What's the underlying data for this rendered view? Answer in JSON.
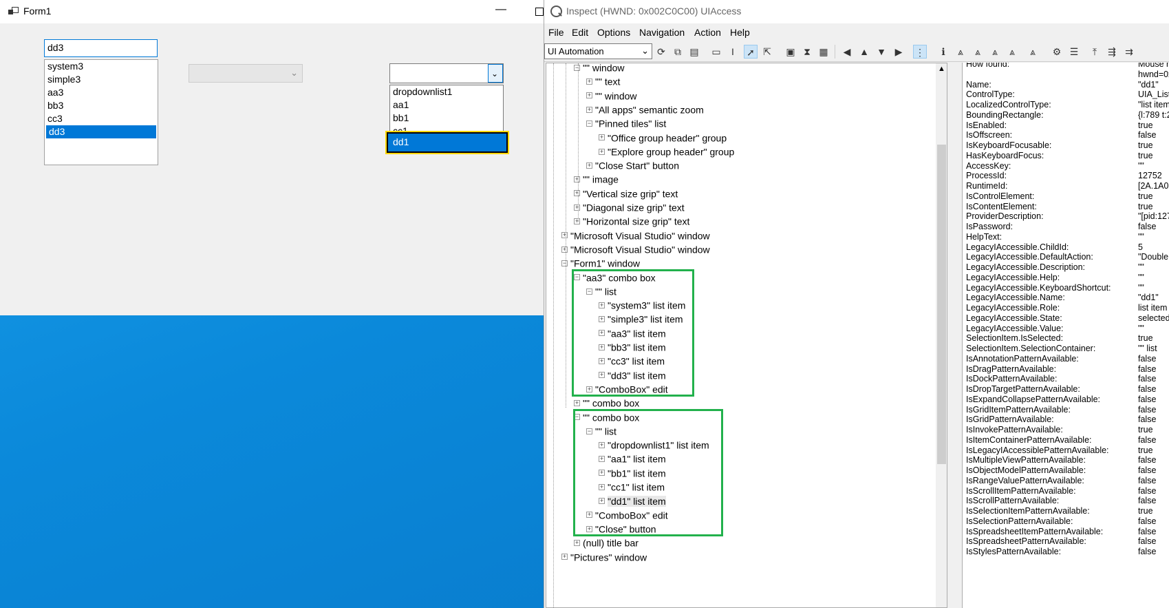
{
  "form1": {
    "title": "Form1",
    "min_glyph": "—",
    "combo1": {
      "edit_value": "dd3",
      "items": [
        "system3",
        "simple3",
        "aa3",
        "bb3",
        "cc3",
        "dd3"
      ],
      "selected_index": 5
    },
    "combo2": {
      "arrow": "⌄"
    },
    "combo3": {
      "arrow": "⌄",
      "items": [
        "dropdownlist1",
        "aa1",
        "bb1",
        "cc1"
      ],
      "selected_item": "dd1"
    }
  },
  "inspect": {
    "title": "Inspect  (HWND: 0x002C0C00) UIAccess",
    "menu": [
      "File",
      "Edit",
      "Options",
      "Navigation",
      "Action",
      "Help"
    ],
    "mode": "UI Automation",
    "tree": [
      {
        "t": "\"\" window",
        "lvl": 2,
        "exp": "−"
      },
      {
        "t": "\"\" text",
        "lvl": 3,
        "exp": "+"
      },
      {
        "t": "\"\" window",
        "lvl": 3,
        "exp": "+"
      },
      {
        "t": "\"All apps\" semantic zoom",
        "lvl": 3,
        "exp": "+"
      },
      {
        "t": "\"Pinned tiles\" list",
        "lvl": 3,
        "exp": "−"
      },
      {
        "t": "\"Office group header\" group",
        "lvl": 4,
        "exp": "+"
      },
      {
        "t": "\"Explore group header\" group",
        "lvl": 4,
        "exp": "+"
      },
      {
        "t": "\"Close Start\" button",
        "lvl": 3,
        "exp": "+"
      },
      {
        "t": "\"\" image",
        "lvl": 2,
        "exp": "+"
      },
      {
        "t": "\"Vertical size grip\" text",
        "lvl": 2,
        "exp": "+"
      },
      {
        "t": "\"Diagonal size grip\" text",
        "lvl": 2,
        "exp": "+"
      },
      {
        "t": "\"Horizontal size grip\" text",
        "lvl": 2,
        "exp": "+"
      },
      {
        "t": "\"Microsoft Visual Studio\" window",
        "lvl": 1,
        "exp": "+"
      },
      {
        "t": "\"Microsoft Visual Studio\" window",
        "lvl": 1,
        "exp": "+"
      },
      {
        "t": "\"Form1\" window",
        "lvl": 1,
        "exp": "−"
      },
      {
        "t": "\"aa3\" combo box",
        "lvl": 2,
        "exp": "−"
      },
      {
        "t": "\"\" list",
        "lvl": 3,
        "exp": "−"
      },
      {
        "t": "\"system3\" list item",
        "lvl": 4,
        "exp": "+"
      },
      {
        "t": "\"simple3\" list item",
        "lvl": 4,
        "exp": "+"
      },
      {
        "t": "\"aa3\" list item",
        "lvl": 4,
        "exp": "+"
      },
      {
        "t": "\"bb3\" list item",
        "lvl": 4,
        "exp": "+"
      },
      {
        "t": "\"cc3\" list item",
        "lvl": 4,
        "exp": "+"
      },
      {
        "t": "\"dd3\" list item",
        "lvl": 4,
        "exp": "+"
      },
      {
        "t": "\"ComboBox\" edit",
        "lvl": 3,
        "exp": "+"
      },
      {
        "t": "\"\" combo box",
        "lvl": 2,
        "exp": "+"
      },
      {
        "t": "\"\" combo box",
        "lvl": 2,
        "exp": "−"
      },
      {
        "t": "\"\" list",
        "lvl": 3,
        "exp": "−"
      },
      {
        "t": "\"dropdownlist1\" list item",
        "lvl": 4,
        "exp": "+"
      },
      {
        "t": "\"aa1\" list item",
        "lvl": 4,
        "exp": "+"
      },
      {
        "t": "\"bb1\" list item",
        "lvl": 4,
        "exp": "+"
      },
      {
        "t": "\"cc1\" list item",
        "lvl": 4,
        "exp": "+"
      },
      {
        "t": "\"dd1\" list item",
        "lvl": 4,
        "exp": "+",
        "hl": true
      },
      {
        "t": "\"ComboBox\" edit",
        "lvl": 3,
        "exp": "+"
      },
      {
        "t": "\"Close\" button",
        "lvl": 3,
        "exp": "+"
      },
      {
        "t": "(null) title bar",
        "lvl": 2,
        "exp": "+"
      },
      {
        "t": "\"Pictures\" window",
        "lvl": 1,
        "exp": "+"
      }
    ],
    "properties": [
      [
        "How found:",
        "Mouse m"
      ],
      [
        "",
        "hwnd=0x"
      ],
      [
        "Name:",
        "\"dd1\""
      ],
      [
        "ControlType:",
        "UIA_List"
      ],
      [
        "LocalizedControlType:",
        "\"list item"
      ],
      [
        "BoundingRectangle:",
        "{l:789 t:2"
      ],
      [
        "IsEnabled:",
        "true"
      ],
      [
        "IsOffscreen:",
        "false"
      ],
      [
        "IsKeyboardFocusable:",
        "true"
      ],
      [
        "HasKeyboardFocus:",
        "true"
      ],
      [
        "AccessKey:",
        "\"\""
      ],
      [
        "ProcessId:",
        "12752"
      ],
      [
        "RuntimeId:",
        "[2A.1A0"
      ],
      [
        "IsControlElement:",
        "true"
      ],
      [
        "IsContentElement:",
        "true"
      ],
      [
        "ProviderDescription:",
        "\"[pid:127"
      ],
      [
        "IsPassword:",
        "false"
      ],
      [
        "HelpText:",
        "\"\""
      ],
      [
        "LegacyIAccessible.ChildId:",
        "5"
      ],
      [
        "LegacyIAccessible.DefaultAction:",
        "\"Double"
      ],
      [
        "LegacyIAccessible.Description:",
        "\"\""
      ],
      [
        "LegacyIAccessible.Help:",
        "\"\""
      ],
      [
        "LegacyIAccessible.KeyboardShortcut:",
        "\"\""
      ],
      [
        "LegacyIAccessible.Name:",
        "\"dd1\""
      ],
      [
        "LegacyIAccessible.Role:",
        "list item"
      ],
      [
        "LegacyIAccessible.State:",
        "selected"
      ],
      [
        "LegacyIAccessible.Value:",
        "\"\""
      ],
      [
        "SelectionItem.IsSelected:",
        "true"
      ],
      [
        "SelectionItem.SelectionContainer:",
        "\"\" list"
      ],
      [
        "IsAnnotationPatternAvailable:",
        "false"
      ],
      [
        "IsDragPatternAvailable:",
        "false"
      ],
      [
        "IsDockPatternAvailable:",
        "false"
      ],
      [
        "IsDropTargetPatternAvailable:",
        "false"
      ],
      [
        "IsExpandCollapsePatternAvailable:",
        "false"
      ],
      [
        "IsGridItemPatternAvailable:",
        "false"
      ],
      [
        "IsGridPatternAvailable:",
        "false"
      ],
      [
        "IsInvokePatternAvailable:",
        "true"
      ],
      [
        "IsItemContainerPatternAvailable:",
        "false"
      ],
      [
        "IsLegacyIAccessiblePatternAvailable:",
        "true"
      ],
      [
        "IsMultipleViewPatternAvailable:",
        "false"
      ],
      [
        "IsObjectModelPatternAvailable:",
        "false"
      ],
      [
        "IsRangeValuePatternAvailable:",
        "false"
      ],
      [
        "IsScrollItemPatternAvailable:",
        "false"
      ],
      [
        "IsScrollPatternAvailable:",
        "false"
      ],
      [
        "IsSelectionItemPatternAvailable:",
        "true"
      ],
      [
        "IsSelectionPatternAvailable:",
        "false"
      ],
      [
        "IsSpreadsheetItemPatternAvailable:",
        "false"
      ],
      [
        "IsSpreadsheetPatternAvailable:",
        "false"
      ],
      [
        "IsStylesPatternAvailable:",
        "false"
      ]
    ],
    "colors": {
      "highlight_box": "#22b14c",
      "selection": "#0078d7",
      "focus_outline": "#ffd800"
    }
  }
}
